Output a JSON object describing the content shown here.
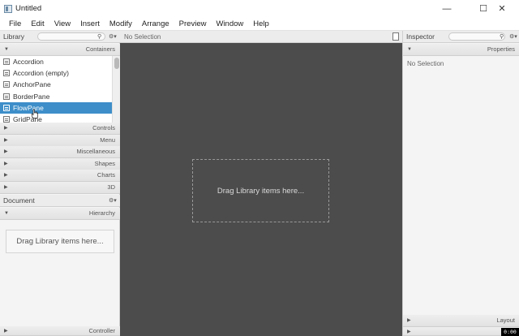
{
  "window": {
    "title": "Untitled",
    "minimize": "—",
    "maximize": "☐",
    "close": "✕"
  },
  "menu": [
    "File",
    "Edit",
    "View",
    "Insert",
    "Modify",
    "Arrange",
    "Preview",
    "Window",
    "Help"
  ],
  "library": {
    "title": "Library",
    "search_placeholder": "",
    "category": "Containers",
    "items": [
      "Accordion",
      "Accordion  (empty)",
      "AnchorPane",
      "BorderPane",
      "FlowPane",
      "GridPane"
    ],
    "selected_index": 4,
    "sections": [
      "Controls",
      "Menu",
      "Miscellaneous",
      "Shapes",
      "Charts",
      "3D"
    ]
  },
  "document": {
    "title": "Document",
    "hierarchy_label": "Hierarchy",
    "drop_hint": "Drag Library items here...",
    "controller_label": "Controller"
  },
  "content": {
    "selection": "No Selection",
    "drop_hint": "Drag Library items here..."
  },
  "inspector": {
    "title": "Inspector",
    "properties_label": "Properties",
    "no_selection": "No Selection",
    "layout_label": "Layout"
  },
  "overlay": {
    "timestamp": "0:00"
  }
}
